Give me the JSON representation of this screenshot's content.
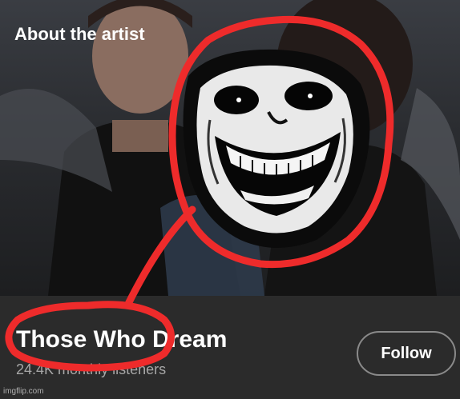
{
  "section": {
    "heading": "About the artist"
  },
  "artist": {
    "name": "Those Who Dream",
    "listeners": "24.4K monthly listeners"
  },
  "actions": {
    "follow_label": "Follow"
  },
  "watermark": "imgflip.com",
  "colors": {
    "background": "#121212",
    "footer": "#2b2b2b",
    "annotation_red": "#ee2b2b",
    "button_border": "#8a8a8a",
    "secondary_text": "#a7a7a7"
  },
  "overlay": {
    "meme_face": "trollface"
  }
}
